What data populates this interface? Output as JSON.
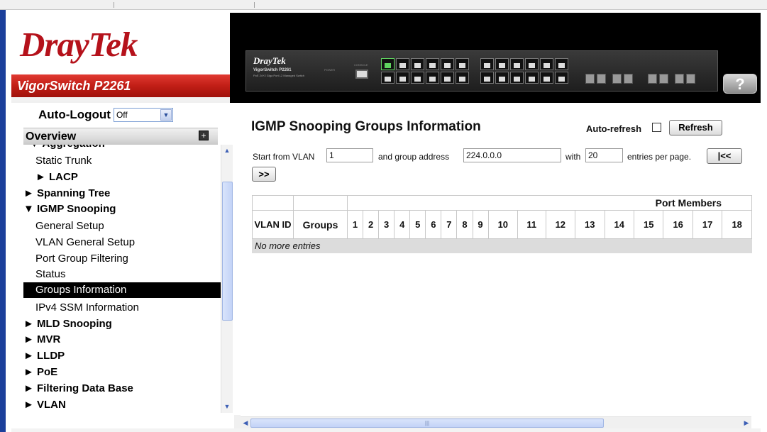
{
  "brand": {
    "logo": "DrayTek",
    "model": "VigorSwitch P2261"
  },
  "device": {
    "brand": "DrayTek",
    "model": "VigorSwitch P2261",
    "subtitle": "PoE 24+2 Giga Port L2 Managed Switch",
    "power_label": "POWER",
    "console_label": "CONSOLE"
  },
  "help": {
    "label": "?"
  },
  "auto_logout": {
    "label": "Auto-Logout",
    "value": "Off"
  },
  "sidebar": {
    "header": "Overview",
    "expand_icon": "plus-icon",
    "items": [
      {
        "label": "▼ Aggregation",
        "level": 1
      },
      {
        "label": "Static Trunk",
        "level": 2
      },
      {
        "label": "► LACP",
        "level": 2
      },
      {
        "label": "► Spanning Tree",
        "level": 1
      },
      {
        "label": "▼ IGMP Snooping",
        "level": 1
      },
      {
        "label": "General Setup",
        "level": 2
      },
      {
        "label": "VLAN General Setup",
        "level": 2
      },
      {
        "label": "Port Group Filtering",
        "level": 2
      },
      {
        "label": "Status",
        "level": 2
      },
      {
        "label": "Groups Information",
        "level": 2,
        "active": true
      },
      {
        "label": "IPv4 SSM Information",
        "level": 2
      },
      {
        "label": "► MLD Snooping",
        "level": 1
      },
      {
        "label": "► MVR",
        "level": 1
      },
      {
        "label": "► LLDP",
        "level": 1
      },
      {
        "label": "► PoE",
        "level": 1
      },
      {
        "label": "► Filtering Data Base",
        "level": 1
      },
      {
        "label": "► VLAN",
        "level": 1
      }
    ]
  },
  "main": {
    "title": "IGMP Snooping Groups Information",
    "auto_refresh_label": "Auto-refresh",
    "auto_refresh_checked": false,
    "refresh_button": "Refresh",
    "filter": {
      "start_label": "Start from VLAN",
      "vlan_value": "1",
      "group_label": "and group address",
      "group_value": "224.0.0.0",
      "with_label": "with",
      "entries_value": "20",
      "entries_label": "entries per page.",
      "first_button": "|<<",
      "next_button": ">>"
    },
    "table": {
      "port_members_header": "Port Members",
      "vlan_header": "VLAN ID",
      "groups_header": "Groups",
      "ports": [
        "1",
        "2",
        "3",
        "4",
        "5",
        "6",
        "7",
        "8",
        "9",
        "10",
        "11",
        "12",
        "13",
        "14",
        "15",
        "16",
        "17",
        "18"
      ],
      "empty_message": "No more entries"
    }
  },
  "colors": {
    "brand_red": "#b5121b",
    "active_menu_bg": "#000000",
    "scrollbar": "#c3d3f7"
  }
}
